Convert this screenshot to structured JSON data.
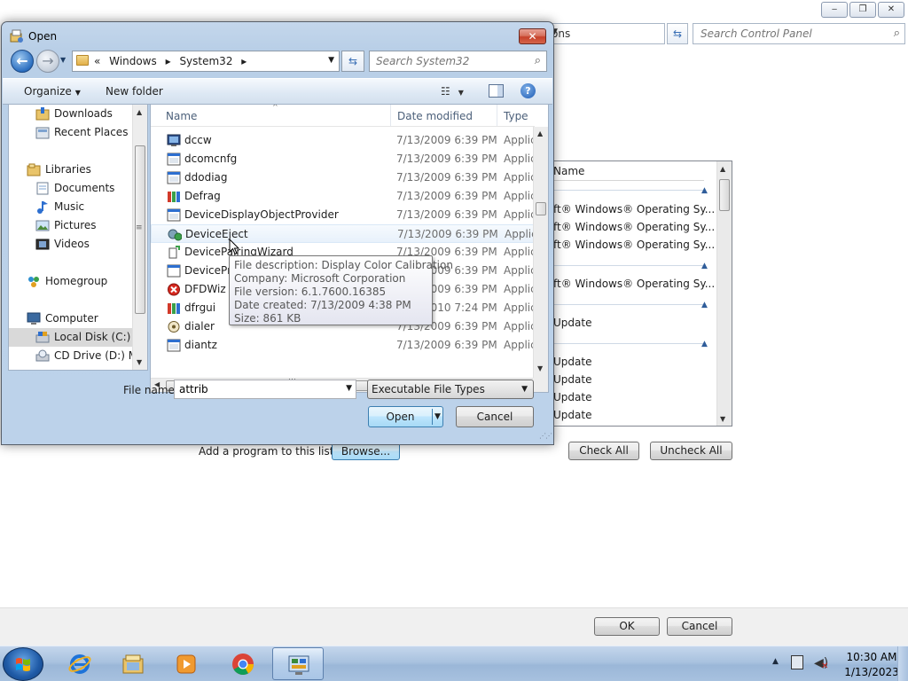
{
  "background_window": {
    "caption_buttons": {
      "minimize": "‒",
      "maximize": "❐",
      "close": "✕"
    },
    "address_partial": "ons",
    "search_placeholder": "Search Control Panel",
    "list": {
      "header_name": "Name",
      "rows": [
        "ft® Windows® Operating Sy...",
        "ft® Windows® Operating Sy...",
        "ft® Windows® Operating Sy...",
        "ft® Windows® Operating Sy...",
        "Update",
        "Update",
        "Update",
        "Update",
        "Update"
      ]
    },
    "add_program_label": "Add a program to this list:",
    "browse_label": "Browse...",
    "check_all_label": "Check All",
    "uncheck_all_label": "Uncheck All",
    "ok_label": "OK",
    "cancel_label": "Cancel"
  },
  "dialog": {
    "title": "Open",
    "close_label": "✕",
    "breadcrumb": [
      "«",
      "Windows",
      "▸",
      "System32",
      "▸"
    ],
    "search_placeholder": "Search System32",
    "toolbar": {
      "organize": "Organize",
      "new_folder": "New folder"
    },
    "nav": [
      {
        "label": "Downloads",
        "icon": "downloads-folder-icon"
      },
      {
        "label": "Recent Places",
        "icon": "recent-places-icon"
      },
      {
        "label": "Libraries",
        "icon": "libraries-icon"
      },
      {
        "label": "Documents",
        "icon": "documents-icon"
      },
      {
        "label": "Music",
        "icon": "music-icon"
      },
      {
        "label": "Pictures",
        "icon": "pictures-icon"
      },
      {
        "label": "Videos",
        "icon": "videos-icon"
      },
      {
        "label": "Homegroup",
        "icon": "homegroup-icon"
      },
      {
        "label": "Computer",
        "icon": "computer-icon"
      },
      {
        "label": "Local Disk (C:)",
        "icon": "local-disk-icon"
      },
      {
        "label": "CD Drive (D:) My",
        "icon": "cd-drive-icon"
      }
    ],
    "columns": {
      "name": "Name",
      "date_modified": "Date modified",
      "type": "Type"
    },
    "files": [
      {
        "name": "dccw",
        "date": "7/13/2009 6:39 PM",
        "type": "Applic"
      },
      {
        "name": "dcomcnfg",
        "date": "7/13/2009 6:39 PM",
        "type": "Applic"
      },
      {
        "name": "ddodiag",
        "date": "7/13/2009 6:39 PM",
        "type": "Applic"
      },
      {
        "name": "Defrag",
        "date": "7/13/2009 6:39 PM",
        "type": "Applic"
      },
      {
        "name": "DeviceDisplayObjectProvider",
        "date": "7/13/2009 6:39 PM",
        "type": "Applic"
      },
      {
        "name": "DeviceEject",
        "date": "7/13/2009 6:39 PM",
        "type": "Applic"
      },
      {
        "name": "DevicePairingWizard",
        "date": "7/13/2009 6:39 PM",
        "type": "Applic"
      },
      {
        "name": "DeviceProperties",
        "date": "7/13/2009 6:39 PM",
        "type": "Applic"
      },
      {
        "name": "DFDWiz",
        "date": "7/13/2009 6:39 PM",
        "type": "Applic"
      },
      {
        "name": "dfrgui",
        "date": "7/14/2010 7:24 PM",
        "type": "Applic"
      },
      {
        "name": "dialer",
        "date": "7/13/2009 6:39 PM",
        "type": "Applic"
      },
      {
        "name": "diantz",
        "date": "7/13/2009 6:39 PM",
        "type": "Applic"
      }
    ],
    "tooltip": {
      "line1": "File description: Display Color Calibration",
      "line2": "Company: Microsoft Corporation",
      "line3": "File version: 6.1.7600.16385",
      "line4": "Date created: 7/13/2009 4:38 PM",
      "line5": "Size: 861 KB"
    },
    "file_name_label": "File name:",
    "file_name_value": "attrib",
    "file_type_value": "Executable File Types",
    "open_label": "Open",
    "cancel_label": "Cancel"
  },
  "taskbar": {
    "apps": [
      {
        "name": "internet-explorer-icon"
      },
      {
        "name": "windows-explorer-icon"
      },
      {
        "name": "media-player-icon"
      },
      {
        "name": "chrome-icon"
      },
      {
        "name": "control-panel-icon",
        "active": true
      }
    ],
    "clock_time": "10:30 AM",
    "clock_date": "1/13/2023"
  },
  "colors": {
    "accent": "#3c7fb1",
    "titlebar": "#c4d7ec",
    "close_red": "#c7412a",
    "taskbar": "#a9c2df"
  }
}
